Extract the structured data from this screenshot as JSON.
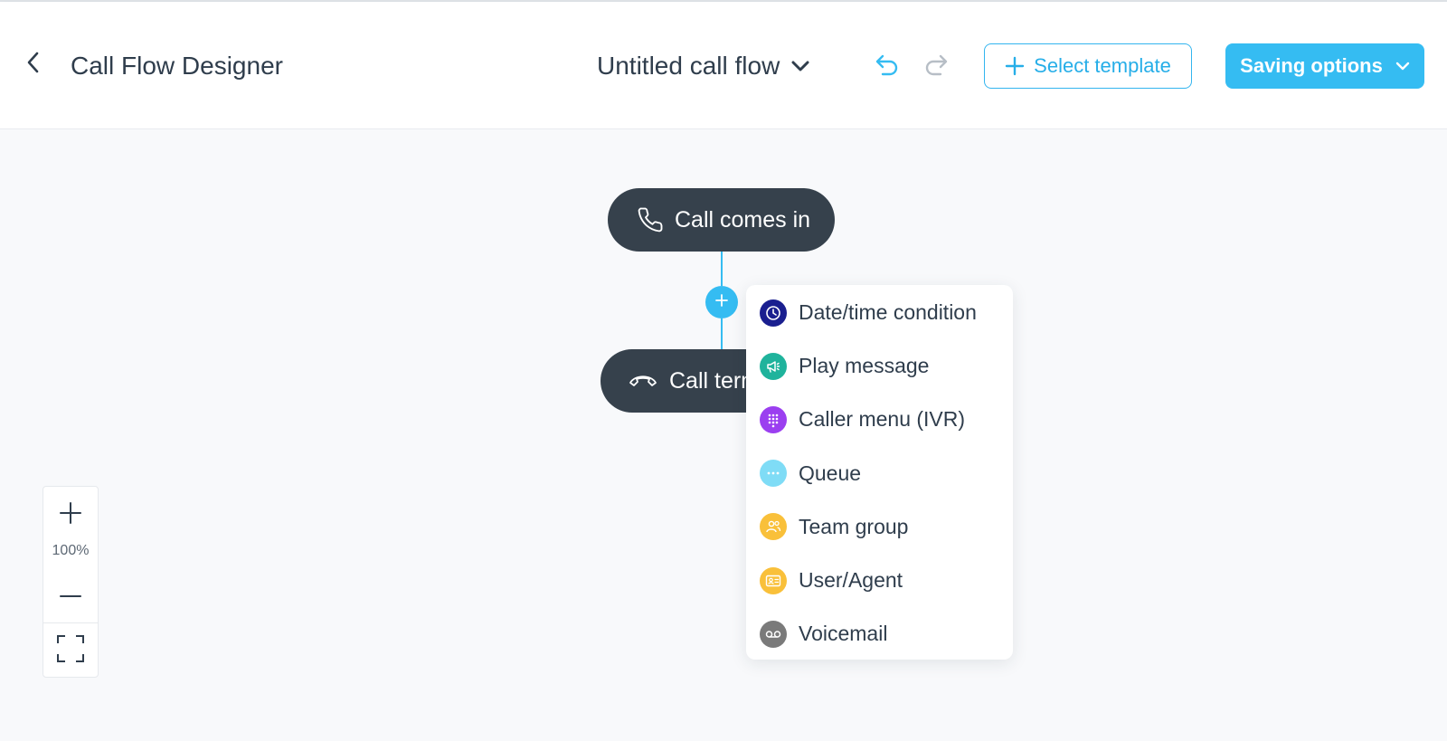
{
  "header": {
    "title": "Call Flow Designer",
    "flow_name": "Untitled call flow",
    "select_template_label": "Select template",
    "saving_options_label": "Saving options",
    "icons": {
      "back": "chevron-left-icon",
      "flow_dropdown": "chevron-down-icon",
      "undo": "undo-icon",
      "redo": "redo-icon",
      "template_plus": "plus-icon",
      "saving_dropdown": "chevron-down-icon"
    }
  },
  "flow": {
    "start_node": {
      "label": "Call comes in",
      "icon": "phone-icon"
    },
    "end_node": {
      "label": "Call terminated",
      "icon": "hang-up-icon"
    },
    "add_step_icon": "plus-icon"
  },
  "step_menu": {
    "items": [
      {
        "label": "Date/time condition",
        "icon": "clock-icon",
        "color": "#1a1f8f"
      },
      {
        "label": "Play message",
        "icon": "megaphone-icon",
        "color": "#1fb39c"
      },
      {
        "label": "Caller menu (IVR)",
        "icon": "keypad-icon",
        "color": "#9b3ff0"
      },
      {
        "label": "Queue",
        "icon": "dots-icon",
        "color": "#7fdcf6"
      },
      {
        "label": "Team group",
        "icon": "group-icon",
        "color": "#f9c03a"
      },
      {
        "label": "User/Agent",
        "icon": "id-card-icon",
        "color": "#f9c03a"
      },
      {
        "label": "Voicemail",
        "icon": "voicemail-icon",
        "color": "#7a7a7a"
      }
    ]
  },
  "zoom": {
    "level": "100%",
    "icons": {
      "in": "plus-icon",
      "out": "minus-icon",
      "fit": "fit-screen-icon"
    }
  },
  "colors": {
    "accent": "#35bcf2",
    "node_bg": "#36414c",
    "text": "#2f3d4c",
    "canvas_bg": "#f8f9fb"
  }
}
